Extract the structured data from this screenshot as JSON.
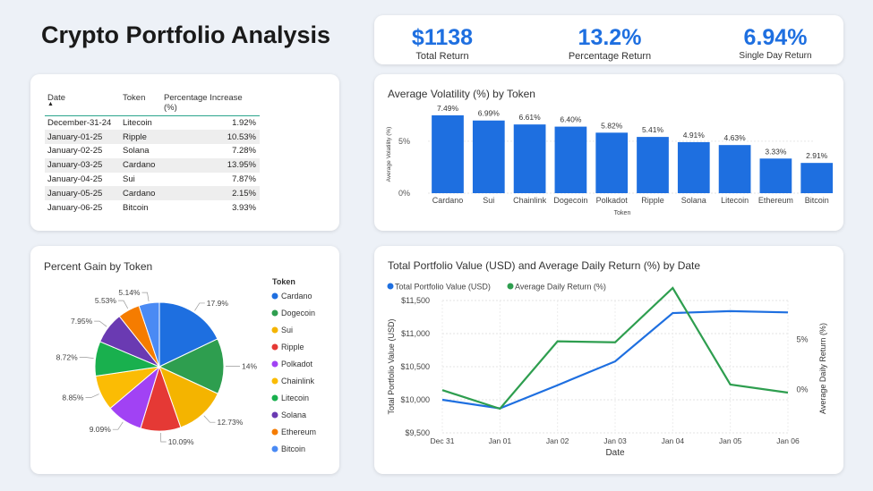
{
  "page_title": "Crypto Portfolio Analysis",
  "kpis": [
    {
      "value": "$1138",
      "label": "Total Return"
    },
    {
      "value": "13.2%",
      "label": "Percentage Return"
    },
    {
      "value": "6.94%",
      "label": "Single Day Return"
    }
  ],
  "table": {
    "headers": [
      "Date",
      "Token",
      "Percentage Increase (%)"
    ],
    "rows": [
      [
        "December-31-24",
        "Litecoin",
        "1.92%"
      ],
      [
        "January-01-25",
        "Ripple",
        "10.53%"
      ],
      [
        "January-02-25",
        "Solana",
        "7.28%"
      ],
      [
        "January-03-25",
        "Cardano",
        "13.95%"
      ],
      [
        "January-04-25",
        "Sui",
        "7.87%"
      ],
      [
        "January-05-25",
        "Cardano",
        "2.15%"
      ],
      [
        "January-06-25",
        "Bitcoin",
        "3.93%"
      ]
    ]
  },
  "colors": {
    "accent": "#1e6fe0",
    "bar": "#1e6fe0",
    "line_value": "#1e6fe0",
    "line_return": "#2e9e4f"
  },
  "chart_data": [
    {
      "type": "bar",
      "title": "Average Volatility (%) by Token",
      "xlabel": "Token",
      "ylabel": "Average Volatility (%)",
      "categories": [
        "Cardano",
        "Sui",
        "Chainlink",
        "Dogecoin",
        "Polkadot",
        "Ripple",
        "Solana",
        "Litecoin",
        "Ethereum",
        "Bitcoin"
      ],
      "values": [
        7.49,
        6.99,
        6.61,
        6.4,
        5.82,
        5.41,
        4.91,
        4.63,
        3.33,
        2.91
      ],
      "data_labels": [
        "7.49%",
        "6.99%",
        "6.61%",
        "6.40%",
        "5.82%",
        "5.41%",
        "4.91%",
        "4.63%",
        "3.33%",
        "2.91%"
      ],
      "yticks": [
        0,
        5
      ],
      "ytick_labels": [
        "0%",
        "5%"
      ],
      "ylim": [
        0,
        8
      ]
    },
    {
      "type": "pie",
      "title": "Percent Gain by Token",
      "legend_title": "Token",
      "legend_position": "right",
      "categories": [
        "Cardano",
        "Dogecoin",
        "Sui",
        "Ripple",
        "Polkadot",
        "Chainlink",
        "Litecoin",
        "Solana",
        "Ethereum",
        "Bitcoin"
      ],
      "values": [
        17.9,
        14.0,
        12.73,
        10.09,
        9.09,
        8.85,
        8.72,
        7.95,
        5.53,
        5.14
      ],
      "data_labels": [
        "17.9%",
        "14%",
        "12.73%",
        "10.09%",
        "9.09%",
        "8.85%",
        "8.72%",
        "7.95%",
        "5.53%",
        "5.14%"
      ],
      "colors": [
        "#1e6fe0",
        "#2e9e4f",
        "#f4b400",
        "#e53935",
        "#a142f4",
        "#fbbc04",
        "#19b04e",
        "#6a3ab2",
        "#f57c00",
        "#4a8af4"
      ]
    },
    {
      "type": "line",
      "title": "Total Portfolio Value (USD) and Average Daily Return (%) by Date",
      "xlabel": "Date",
      "ylabel": "Total Portfolio Value (USD)",
      "y2label": "Average Daily Return (%)",
      "categories": [
        "Dec 31",
        "Jan 01",
        "Jan 02",
        "Jan 03",
        "Jan 04",
        "Jan 05",
        "Jan 06"
      ],
      "series": [
        {
          "name": "Total Portfolio Value (USD)",
          "axis": "left",
          "values": [
            10000,
            9870,
            10220,
            10580,
            11310,
            11340,
            11320
          ]
        },
        {
          "name": "Average Daily Return (%)",
          "axis": "right",
          "values": [
            -0.05,
            -1.9,
            4.8,
            4.7,
            10.1,
            0.5,
            -0.3
          ]
        }
      ],
      "yticks": [
        9500,
        10000,
        10500,
        11000,
        11500
      ],
      "ytick_labels": [
        "$9,500",
        "$10,000",
        "$10,500",
        "$11,000",
        "$11,500"
      ],
      "ylim": [
        9500,
        11500
      ],
      "y2ticks": [
        0,
        5
      ],
      "y2tick_labels": [
        "0%",
        "5%"
      ],
      "y2lim": [
        -4.3,
        10.1
      ],
      "legend_position": "top-left"
    }
  ]
}
